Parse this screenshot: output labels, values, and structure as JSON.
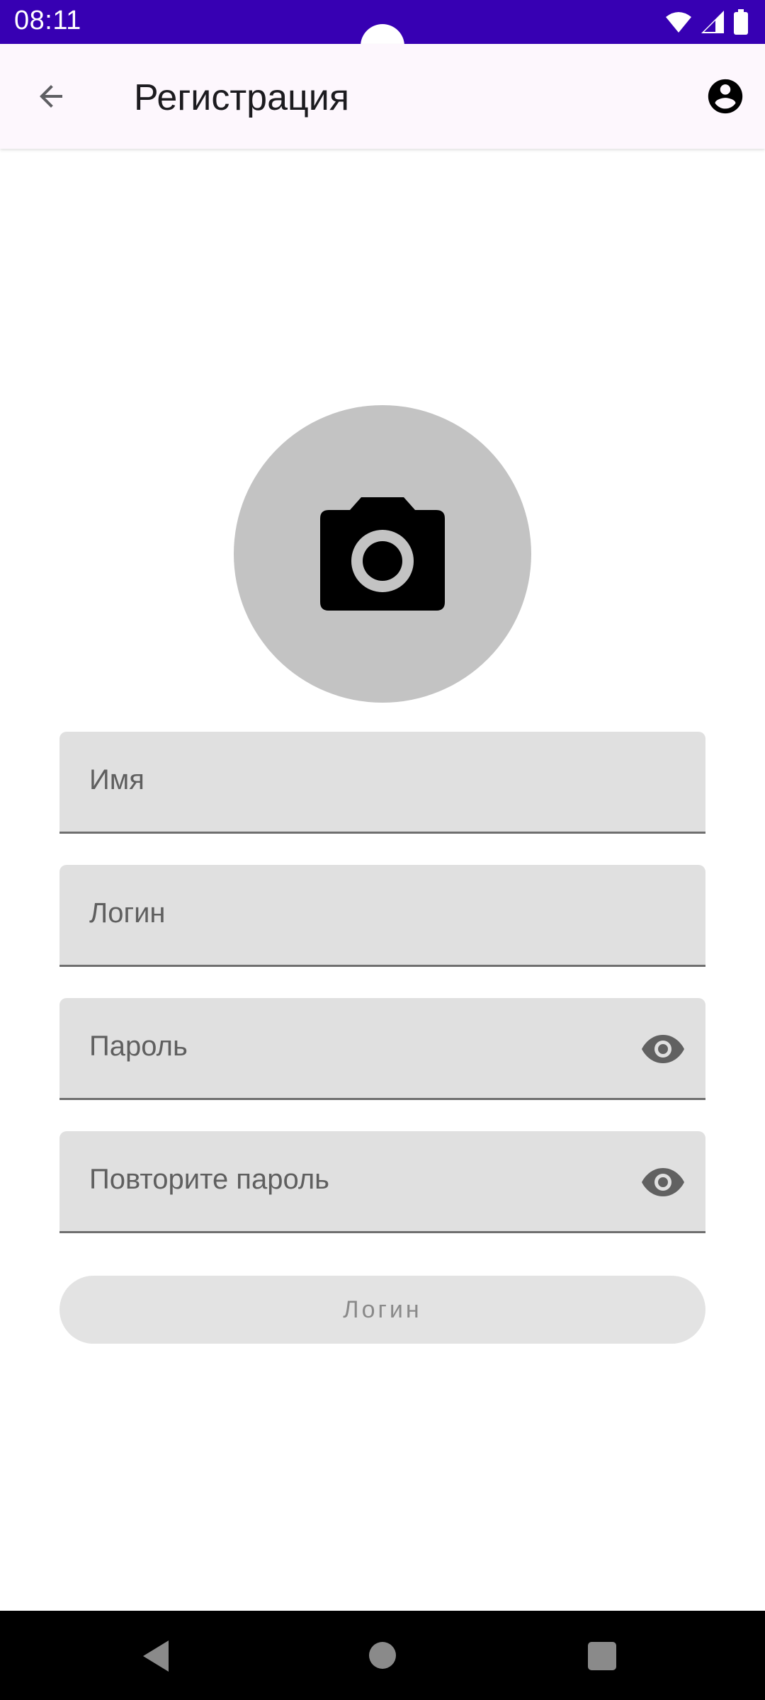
{
  "status_bar": {
    "time": "08:11",
    "background": "#3700b3"
  },
  "app_bar": {
    "title": "Регистрация",
    "back_icon": "arrow-back-icon",
    "account_icon": "account-circle-icon"
  },
  "avatar": {
    "icon": "camera-icon"
  },
  "form": {
    "name_placeholder": "Имя",
    "login_placeholder": "Логин",
    "password_placeholder": "Пароль",
    "repeat_password_placeholder": "Повторите пароль",
    "visibility_icon": "eye-icon"
  },
  "actions": {
    "submit_label": "Логин"
  },
  "colors": {
    "accent": "#3700b3",
    "field_background": "#e0e0e0",
    "avatar_background": "#c3c3c3"
  }
}
